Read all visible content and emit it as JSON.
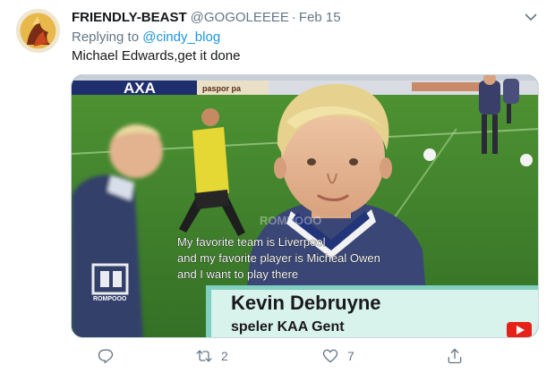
{
  "tweet": {
    "display_name": "FRIENDLY-BEAST",
    "handle": "@GOGOLEEEE",
    "separator": "·",
    "date": "Feb 15",
    "replying_prefix": "Replying to",
    "replying_to": "@cindy_blog",
    "text": "Michael Edwards,get it done"
  },
  "media": {
    "ad_board_text": "AXA",
    "ad_board_secondary": "paspor pa",
    "watermark": "ROMPOOO",
    "subtitle_lines": [
      "My favorite team is Liverpool",
      "and my favorite player is Micheal Owen",
      "and I want to play there"
    ],
    "lower_third_name": "Kevin Debruyne",
    "lower_third_caption": "speler KAA Gent",
    "logo_text": "ROMPOOO",
    "colors": {
      "pitch": "#3f7e2c",
      "lower_third": "#d8f2ec",
      "lower_third_accent": "#7fd0c0"
    }
  },
  "actions": {
    "reply_count": "",
    "retweet_count": "2",
    "like_count": "7",
    "share_count": ""
  },
  "icons": [
    "chevron-down-icon",
    "reply-icon",
    "retweet-icon",
    "like-icon",
    "share-icon",
    "youtube-icon"
  ]
}
